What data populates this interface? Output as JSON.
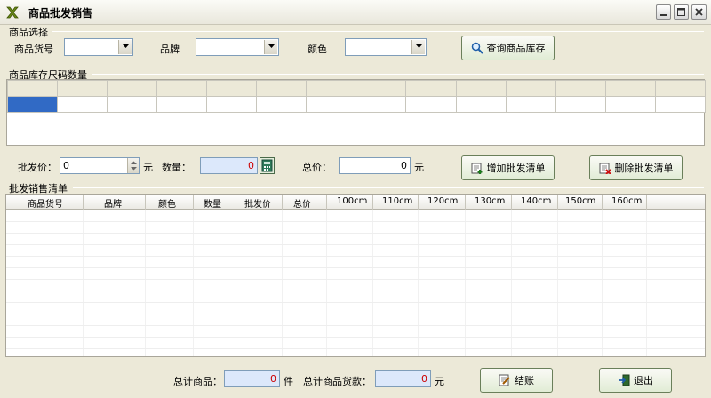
{
  "window": {
    "title": "商品批发销售"
  },
  "product_select": {
    "section_label": "商品选择",
    "item_no_label": "商品货号",
    "brand_label": "品牌",
    "color_label": "颜色",
    "item_no_value": "",
    "brand_value": "",
    "color_value": "",
    "query_button": "查询商品库存"
  },
  "stock_grid": {
    "section_label": "商品库存尺码数量"
  },
  "entry": {
    "price_label": "批发价：",
    "price_value": "0",
    "price_unit": "元",
    "qty_label": "数量：",
    "qty_value": "0",
    "total_label": "总价：",
    "total_value": "0",
    "total_unit": "元",
    "add_button": "增加批发清单",
    "delete_button": "删除批发清单"
  },
  "sales_list": {
    "section_label": "批发销售清单",
    "columns": [
      "商品货号",
      "品牌",
      "颜色",
      "数量",
      "批发价",
      "总价",
      "100cm",
      "110cm",
      "120cm",
      "130cm",
      "140cm",
      "150cm",
      "160cm"
    ]
  },
  "footer": {
    "total_goods_label": "总计商品：",
    "total_goods_value": "0",
    "total_goods_unit": "件",
    "total_amount_label": "总计商品货款：",
    "total_amount_value": "0",
    "total_amount_unit": "元",
    "checkout_button": "结账",
    "exit_button": "退出"
  },
  "colors": {
    "selection_blue": "#316ac5",
    "accent_red": "#cc0000"
  },
  "icons": [
    "app-logo-icon",
    "minimize-icon",
    "maximize-icon",
    "close-icon",
    "search-icon",
    "calculator-icon",
    "add-list-icon",
    "delete-list-icon",
    "checkout-icon",
    "exit-icon",
    "spinner-icon",
    "dropdown-arrow-icon"
  ]
}
